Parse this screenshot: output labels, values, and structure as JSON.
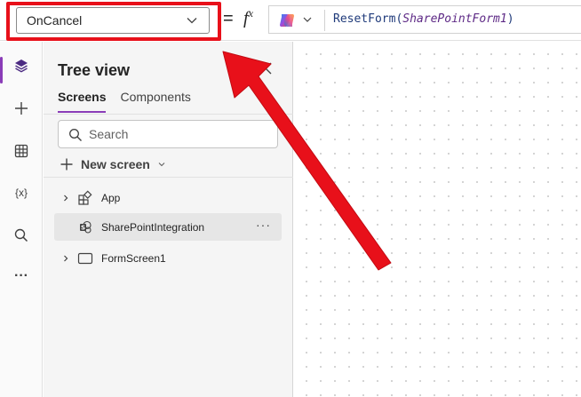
{
  "formula_bar": {
    "property_value": "OnCancel",
    "equals": "=",
    "fx": "fx",
    "formula_func": "ResetForm(",
    "formula_arg": "SharePointForm1",
    "formula_close": ")",
    "copilot_icon": "copilot-icon",
    "highlight_color": "#e8101a"
  },
  "rail": {
    "items": [
      {
        "icon": "layers-icon",
        "active": true
      },
      {
        "icon": "plus-icon"
      },
      {
        "icon": "table-icon"
      },
      {
        "icon": "variables-icon",
        "text": "{x}"
      },
      {
        "icon": "search-icon"
      },
      {
        "icon": "more-icon",
        "text": "···"
      }
    ],
    "accent": "#8a3cb8"
  },
  "tree": {
    "title": "Tree view",
    "tabs": [
      "Screens",
      "Components"
    ],
    "active_tab": "Screens",
    "search_placeholder": "Search",
    "new_screen": "New screen",
    "nodes": [
      {
        "label": "App",
        "icon": "app-icon",
        "expandable": true
      },
      {
        "label": "SharePointIntegration",
        "icon": "sharepoint-icon",
        "selected": true,
        "more": "···"
      },
      {
        "label": "FormScreen1",
        "icon": "screen-icon",
        "expandable": true
      }
    ]
  }
}
